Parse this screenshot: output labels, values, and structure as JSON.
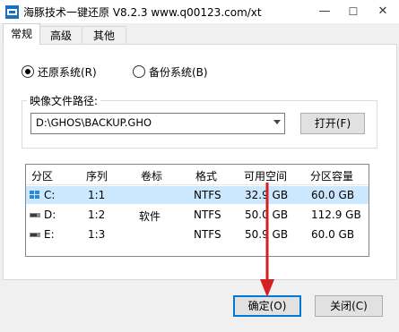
{
  "window": {
    "title": "海豚技术一键还原 V8.2.3 www.q00123.com/xt",
    "minimize": "—",
    "maximize": "☐",
    "close": "✕"
  },
  "tabs": [
    {
      "label": "常规",
      "active": true
    },
    {
      "label": "高级",
      "active": false
    },
    {
      "label": "其他",
      "active": false
    }
  ],
  "mode": {
    "restore_label": "还原系统(R)",
    "backup_label": "备份系统(B)",
    "selected": "restore"
  },
  "image_path": {
    "group_label": "映像文件路径:",
    "value": "D:\\GHOS\\BACKUP.GHO",
    "open_button": "打开(F)"
  },
  "partition_table": {
    "columns": [
      "分区",
      "序列",
      "卷标",
      "格式",
      "可用空间",
      "分区容量"
    ],
    "rows": [
      {
        "partition": "C:",
        "index": "1:1",
        "label": "",
        "format": "NTFS",
        "free": "32.9 GB",
        "capacity": "60.0 GB",
        "selected": true,
        "icon": "windows-drive-icon"
      },
      {
        "partition": "D:",
        "index": "1:2",
        "label": "软件",
        "format": "NTFS",
        "free": "50.0 GB",
        "capacity": "112.9 GB",
        "selected": false,
        "icon": "drive-icon"
      },
      {
        "partition": "E:",
        "index": "1:3",
        "label": "",
        "format": "NTFS",
        "free": "50.9 GB",
        "capacity": "60.0 GB",
        "selected": false,
        "icon": "drive-icon"
      }
    ]
  },
  "buttons": {
    "ok": "确定(O)",
    "close": "关闭(C)"
  },
  "colors": {
    "accent": "#0078d7",
    "selection": "#cce8ff",
    "arrow": "#d42020"
  }
}
